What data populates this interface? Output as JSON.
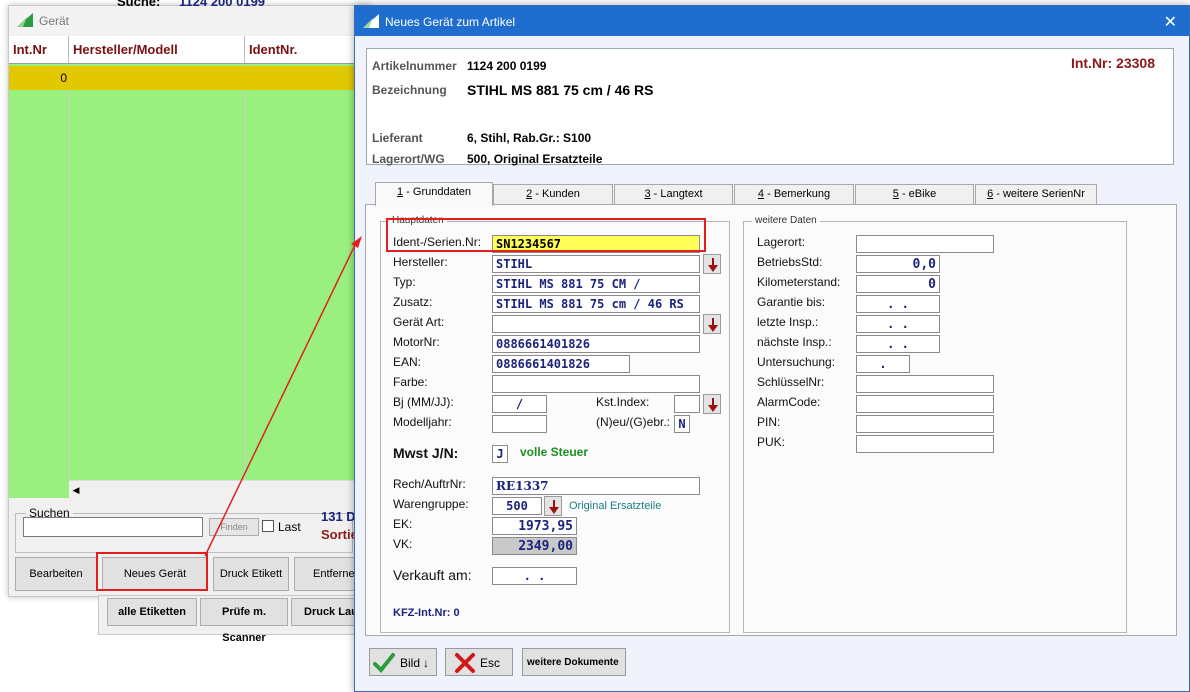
{
  "back_window": {
    "title": "Gerät",
    "top_search_label": "Suche:",
    "top_search_value": "1124 200 0199",
    "grid": {
      "columns": [
        "Int.Nr",
        "Hersteller/Modell",
        "IdentNr."
      ],
      "rows": [
        {
          "int_nr": "0"
        }
      ]
    },
    "search": {
      "group_label": "Suchen",
      "placeholder": "",
      "find_button": "Finden",
      "last_label": "Last"
    },
    "info_line1": "131 D",
    "info_line2": "Sortie",
    "buttons": {
      "edit": "Bearbeiten",
      "new_device": "Neues Gerät",
      "print_label": "Druck Etikett",
      "remove": "Entfernen"
    },
    "strip_buttons": {
      "all_labels": "alle Etiketten",
      "check_scanner": "Prüfe m. Scanner",
      "print_run": "Druck Lau"
    }
  },
  "dialog": {
    "title": "Neues Gerät zum Artikel",
    "close_symbol": "✕",
    "article": {
      "artikelnummer_label": "Artikelnummer",
      "artikelnummer": "1124 200 0199",
      "bezeichnung_label": "Bezeichnung",
      "bezeichnung": "STIHL MS 881 75 cm / 46 RS",
      "lieferant_label": "Lieferant",
      "lieferant": "6, Stihl, Rab.Gr.: S100",
      "lagerort_label": "Lagerort/WG",
      "lagerort": "500, Original Ersatzteile",
      "int_nr": "Int.Nr: 23308"
    },
    "tabs": [
      {
        "key": "1",
        "label": " - Grunddaten"
      },
      {
        "key": "2",
        "label": " - Kunden"
      },
      {
        "key": "3",
        "label": " - Langtext"
      },
      {
        "key": "4",
        "label": " - Bemerkung"
      },
      {
        "key": "5",
        "label": " - eBike"
      },
      {
        "key": "6",
        "label": " - weitere SerienNr"
      }
    ],
    "hauptdaten": {
      "group_label": "Hauptdaten",
      "ident_label": "Ident-/Serien.Nr:",
      "ident_value": "SN1234567",
      "hersteller_label": "Hersteller:",
      "hersteller_value": "STIHL",
      "typ_label": "Typ:",
      "typ_value": "STIHL MS 881 75 CM /",
      "zusatz_label": "Zusatz:",
      "zusatz_value": "STIHL MS 881 75 cm / 46 RS",
      "geraet_art_label": "Gerät Art:",
      "geraet_art_value": "",
      "motornr_label": "MotorNr:",
      "motornr_value": "0886661401826",
      "ean_label": "EAN:",
      "ean_value": "0886661401826",
      "farbe_label": "Farbe:",
      "farbe_value": "",
      "bj_label": "Bj (MM/JJ):",
      "bj_value": "/",
      "kst_label": "Kst.Index:",
      "kst_value": "",
      "modelljahr_label": "Modelljahr:",
      "modelljahr_value": "",
      "neu_label": "(N)eu/(G)ebr.:",
      "neu_value": "N",
      "mwst_label": "Mwst J/N:",
      "mwst_value": "J",
      "mwst_text": "volle Steuer",
      "rech_label": "Rech/AuftrNr:",
      "rech_value": "RE1337",
      "warengruppe_label": "Warengruppe:",
      "warengruppe_value": "500",
      "warengruppe_text": "Original Ersatzteile",
      "ek_label": "EK:",
      "ek_value": "1973,95",
      "vk_label": "VK:",
      "vk_value": "2349,00",
      "verkauft_label": "Verkauft am:",
      "verkauft_value": ".   .",
      "kfz_label": "KFZ-Int.Nr: 0"
    },
    "weitere": {
      "group_label": "weitere Daten",
      "lagerort_label": "Lagerort:",
      "lagerort_value": "",
      "betriebsstd_label": "BetriebsStd:",
      "betriebsstd_value": "0,0",
      "km_label": "Kilometerstand:",
      "km_value": "0",
      "garantie_label": "Garantie bis:",
      "garantie_value": ".   .",
      "letzte_label": "letzte Insp.:",
      "letzte_value": ".   .",
      "naechste_label": "nächste Insp.:",
      "naechste_value": ".   .",
      "untersuchung_label": "Untersuchung:",
      "untersuchung_value": ".",
      "schluessel_label": "SchlüsselNr:",
      "schluessel_value": "",
      "alarm_label": "AlarmCode:",
      "alarm_value": "",
      "pin_label": "PIN:",
      "pin_value": "",
      "puk_label": "PUK:",
      "puk_value": ""
    },
    "buttons": {
      "bild": "Bild",
      "esc": "Esc",
      "weitere_dokumente": "weitere Dokumente"
    }
  },
  "colors": {
    "title_blue": "#1f6ecf",
    "grid_green": "#99f07f",
    "row_yellow": "#e1c800",
    "ident_yellow": "#ffff55",
    "annotation_red": "#e02020",
    "dark_red": "#8b1a1a"
  }
}
